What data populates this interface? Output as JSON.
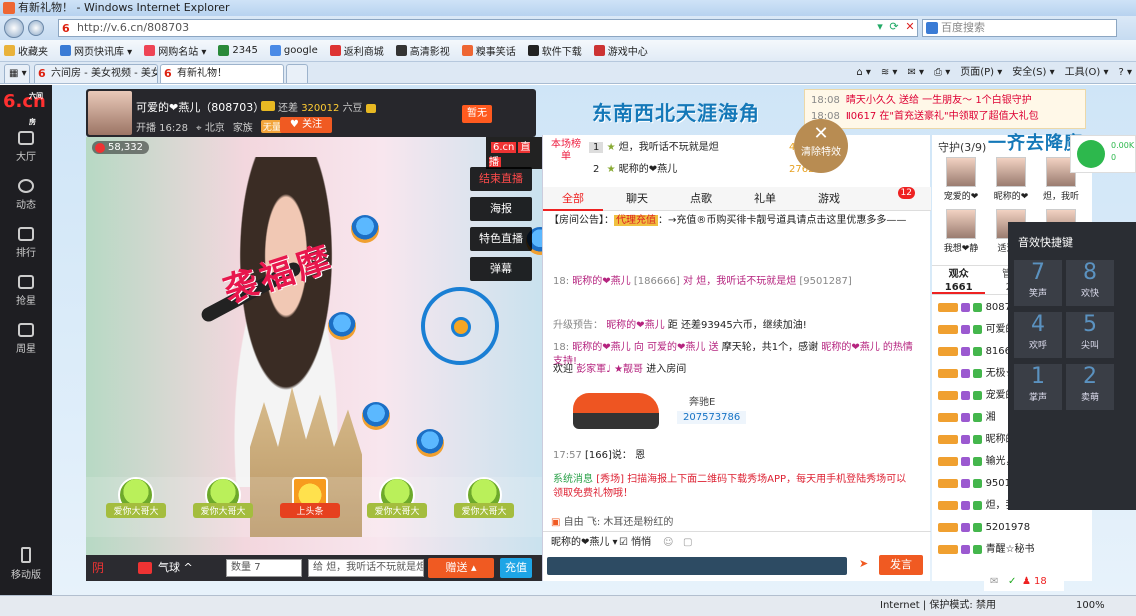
{
  "window": {
    "title": "有新礼物！ - Windows Internet Explorer"
  },
  "address": {
    "url": "http://v.6.cn/808703",
    "url_host_icon": "6",
    "search_placeholder": "百度搜索"
  },
  "favorites": [
    {
      "label": "收藏夹",
      "color": "#e9b23a"
    },
    {
      "label": "网页快讯库 ▾",
      "color": "#3a7bd5"
    },
    {
      "label": "网购名站 ▾",
      "color": "#e45"
    },
    {
      "label": "2345",
      "color": "#2a8a3a"
    },
    {
      "label": "google",
      "color": "#4a8ae6"
    },
    {
      "label": "返利商城",
      "color": "#d33"
    },
    {
      "label": "高清影视",
      "color": "#333"
    },
    {
      "label": "糗事笑话",
      "color": "#e63"
    },
    {
      "label": "软件下载",
      "color": "#222"
    },
    {
      "label": "游戏中心",
      "color": "#c33"
    }
  ],
  "tabs": [
    {
      "icon": "6",
      "label": "六间房 - 美女视频 - 美女..."
    },
    {
      "icon": "6",
      "label": "有新礼物！"
    }
  ],
  "commands": [
    "页面(P) ▾",
    "安全(S) ▾",
    "工具(O) ▾",
    "? ▾"
  ],
  "leftnav": {
    "logo_brand": "6.cn",
    "logo_top": "六间房",
    "items": [
      "大厅",
      "动态",
      "排行",
      "抢星",
      "周星"
    ],
    "mobile": "移动版"
  },
  "host": {
    "name": "可爱的❤燕儿（808703）",
    "rest_prefix": "还差",
    "rest_value": "320012",
    "rest_suffix": "六豆",
    "start_time": "开播 16:28",
    "location": "北京",
    "family": "家族",
    "fan_badge": "无量",
    "follow": "关注",
    "zanwu": "暂无"
  },
  "video": {
    "viewers": "58,332",
    "brand": "6.cn",
    "brand_live": "直播",
    "gift_effect_text": "袭福摩",
    "menu": [
      "结束直播",
      "海报",
      "特色直播",
      "弹幕"
    ]
  },
  "gifts": [
    {
      "label": "爱你大哥大",
      "special": false
    },
    {
      "label": "爱你大哥大",
      "special": false
    },
    {
      "label": "上头条",
      "special": true
    },
    {
      "label": "爱你大哥大",
      "special": false
    },
    {
      "label": "爱你大哥大",
      "special": false
    }
  ],
  "giftbar": {
    "qiqiu": "气球 ^",
    "qty_label": "数量",
    "qty_value": "7",
    "to_label": "给",
    "to_value": "炟，我听话不玩就是炟",
    "send": "赠送",
    "recharge": "充值"
  },
  "banner": {
    "slogan_left": "东南西北天涯海角",
    "slogan_right": "一齐去降魔"
  },
  "notify": [
    {
      "time": "18:08",
      "text": "晴天小久久 送给 一生朋友～ 1个白银守护"
    },
    {
      "time": "18:08",
      "text": "Ⅱ0617 在\"首充送豪礼\"中领取了超值大礼包"
    }
  ],
  "clear_effect": "清除特效",
  "rank": {
    "title": "本场榜单",
    "rows": [
      {
        "rank": "1",
        "name": "炟，我听话不玩就是炟",
        "score": "4"
      },
      {
        "rank": "2",
        "name": "昵称的❤燕儿",
        "score": "27620"
      }
    ]
  },
  "chat_tabs": [
    "全部",
    "聊天",
    "点歌",
    "礼单",
    "游戏"
  ],
  "chat_badge": "12",
  "announce": {
    "prefix": "【房间公告】：",
    "tag": "代理充值",
    "text": "：→充值®币购买徘卡靓号道具请点击这里优惠多多——"
  },
  "messages": [
    {
      "time": "18:",
      "name": "昵称的❤燕儿",
      "num": "[186666]",
      "to": "对 炟，我听话不玩就是炟",
      "tail": "[9501287]"
    },
    {
      "label": "升级预告：",
      "name": "昵称的❤燕儿",
      "text": "距",
      "rest": "还差93945六币，继续加油!"
    },
    {
      "time": "18:",
      "name": "昵称的❤燕儿",
      "text": "向 可爱的❤燕儿 送",
      "gift": "摩天轮，共1个，感谢",
      "thanks": "昵称的❤燕儿 的热情支持!"
    },
    {
      "label": "欢迎",
      "name": "彭家軍♩ ★靓哥",
      "text": "进入房间"
    }
  ],
  "car": {
    "name": "奔驰E",
    "num": "207573786"
  },
  "last_msg": {
    "time": "17:57",
    "text": "[166]说： 恩"
  },
  "system_msg": {
    "label": "系统消息",
    "source": "[秀场]",
    "text": "扫描海报上下面二维码下载秀场APP，每天用手机登陆秀场可以领取免费礼物哦！"
  },
  "private_msg": "自由 飞: 木耳还是粉红的",
  "chat_input": {
    "to": "昵称的❤燕儿 ▾",
    "whisper": "悄悄",
    "send": "发言"
  },
  "guard": {
    "title": "守护(3/9)",
    "members": [
      "宠爱的❤",
      "昵称的❤",
      "炟，我听",
      "我想❤静",
      "适逐の",
      "无极★代"
    ]
  },
  "viewer_tabs": [
    {
      "label": "观众",
      "count": "1661"
    },
    {
      "label": "管理",
      "count": "20"
    },
    {
      "label": "麦序",
      "count": "0"
    }
  ],
  "viewers_list": [
    "808703",
    "可爱的❤燕儿",
    "8166",
    "无极★国王",
    "宠爱的❤燕儿",
    "湘",
    "昵称的❤燕儿",
    "输光，被",
    "9501287",
    "炟，我听话不玩就是炟",
    "5201978",
    "青醒☆秘书"
  ],
  "sfx": {
    "title": "音效快捷键",
    "keys": [
      {
        "n": "7",
        "l": "笑声"
      },
      {
        "n": "8",
        "l": "欢快"
      },
      {
        "n": "4",
        "l": "欢呼"
      },
      {
        "n": "5",
        "l": "尖叫"
      },
      {
        "n": "1",
        "l": "掌声"
      },
      {
        "n": "2",
        "l": "卖萌"
      }
    ]
  },
  "wifi": {
    "line1": "0.00K",
    "line2": "0"
  },
  "bottom_badge": "18",
  "statusbar": {
    "zone": "Internet | 保护模式: 禁用",
    "zoom": "100%"
  }
}
